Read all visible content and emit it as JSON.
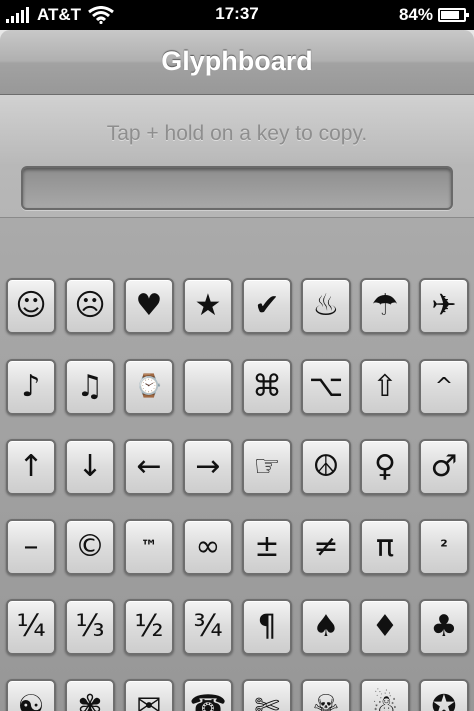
{
  "status_bar": {
    "carrier": "AT&T",
    "time": "17:37",
    "battery_percent": "84%",
    "battery_level": 0.84,
    "signal_bars": 5,
    "wifi_icon": "wifi-icon"
  },
  "nav": {
    "title": "Glyphboard"
  },
  "hint": "Tap + hold on a key to copy.",
  "copy_field": {
    "value": ""
  },
  "keys": [
    [
      "☺",
      "☹",
      "♥",
      "★",
      "✔",
      "♨",
      "☂",
      "✈"
    ],
    [
      "♪",
      "♫",
      "⌚",
      "",
      "⌘",
      "⌥",
      "⇧",
      "^"
    ],
    [
      "↑",
      "↓",
      "←",
      "→",
      "☞",
      "☮",
      "♀",
      "♂"
    ],
    [
      "–",
      "©",
      "™",
      "∞",
      "±",
      "≠",
      "π",
      "²"
    ],
    [
      "¼",
      "⅓",
      "½",
      "¾",
      "¶",
      "♠",
      "♦",
      "♣"
    ],
    [
      "☯",
      "✾",
      "✉",
      "☎",
      "✄",
      "☠",
      "☃",
      "✪"
    ]
  ]
}
